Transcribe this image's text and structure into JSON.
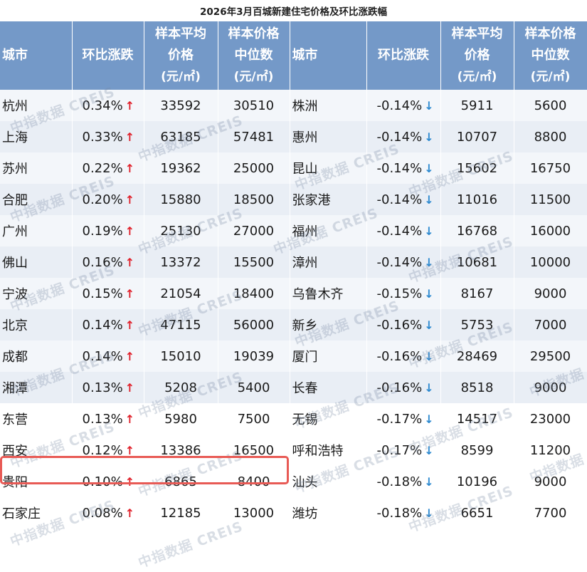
{
  "title": "2026年3月百城新建住宅价格及环比涨跌幅",
  "headers": {
    "city": "城市",
    "change": "环比涨跌",
    "avg_line1": "样本平均",
    "avg_line2": "价格",
    "median_line1": "样本价格",
    "median_line2": "中位数",
    "unit": "(元/㎡)"
  },
  "watermark": "中指数据 CREIS",
  "colors": {
    "header_bg": "#7499c8",
    "up_arrow": "#e0212b",
    "down_arrow": "#2e8ad0",
    "highlight": "#e85a55"
  },
  "rows": [
    {
      "l_city": "杭州",
      "l_change": "0.34%",
      "l_avg": "33592",
      "l_median": "30510",
      "r_city": "株洲",
      "r_change": "-0.14%",
      "r_avg": "5911",
      "r_median": "5600"
    },
    {
      "l_city": "上海",
      "l_change": "0.33%",
      "l_avg": "63185",
      "l_median": "57481",
      "r_city": "惠州",
      "r_change": "-0.14%",
      "r_avg": "10707",
      "r_median": "8800"
    },
    {
      "l_city": "苏州",
      "l_change": "0.22%",
      "l_avg": "19362",
      "l_median": "25000",
      "r_city": "昆山",
      "r_change": "-0.14%",
      "r_avg": "15602",
      "r_median": "16750"
    },
    {
      "l_city": "合肥",
      "l_change": "0.20%",
      "l_avg": "15880",
      "l_median": "18500",
      "r_city": "张家港",
      "r_change": "-0.14%",
      "r_avg": "11016",
      "r_median": "11500"
    },
    {
      "l_city": "广州",
      "l_change": "0.19%",
      "l_avg": "25130",
      "l_median": "27000",
      "r_city": "福州",
      "r_change": "-0.14%",
      "r_avg": "16768",
      "r_median": "16000"
    },
    {
      "l_city": "佛山",
      "l_change": "0.16%",
      "l_avg": "13372",
      "l_median": "15500",
      "r_city": "漳州",
      "r_change": "-0.14%",
      "r_avg": "10681",
      "r_median": "10000"
    },
    {
      "l_city": "宁波",
      "l_change": "0.15%",
      "l_avg": "21054",
      "l_median": "18400",
      "r_city": "乌鲁木齐",
      "r_change": "-0.15%",
      "r_avg": "8167",
      "r_median": "9000"
    },
    {
      "l_city": "北京",
      "l_change": "0.14%",
      "l_avg": "47115",
      "l_median": "56000",
      "r_city": "新乡",
      "r_change": "-0.16%",
      "r_avg": "5753",
      "r_median": "7000"
    },
    {
      "l_city": "成都",
      "l_change": "0.14%",
      "l_avg": "15010",
      "l_median": "19039",
      "r_city": "厦门",
      "r_change": "-0.16%",
      "r_avg": "28469",
      "r_median": "29500"
    },
    {
      "l_city": "湘潭",
      "l_change": "0.13%",
      "l_avg": "5208",
      "l_median": "5400",
      "r_city": "长春",
      "r_change": "-0.16%",
      "r_avg": "8518",
      "r_median": "9000"
    },
    {
      "l_city": "东营",
      "l_change": "0.13%",
      "l_avg": "5980",
      "l_median": "7500",
      "r_city": "无锡",
      "r_change": "-0.17%",
      "r_avg": "14517",
      "r_median": "23000"
    },
    {
      "l_city": "西安",
      "l_change": "0.12%",
      "l_avg": "13386",
      "l_median": "16500",
      "r_city": "呼和浩特",
      "r_change": "-0.17%",
      "r_avg": "8599",
      "r_median": "11200"
    },
    {
      "l_city": "贵阳",
      "l_change": "0.10%",
      "l_avg": "6865",
      "l_median": "8400",
      "r_city": "汕头",
      "r_change": "-0.18%",
      "r_avg": "10196",
      "r_median": "9000"
    },
    {
      "l_city": "石家庄",
      "l_change": "0.08%",
      "l_avg": "12185",
      "l_median": "13000",
      "r_city": "潍坊",
      "r_change": "-0.18%",
      "r_avg": "6651",
      "r_median": "7700"
    }
  ]
}
